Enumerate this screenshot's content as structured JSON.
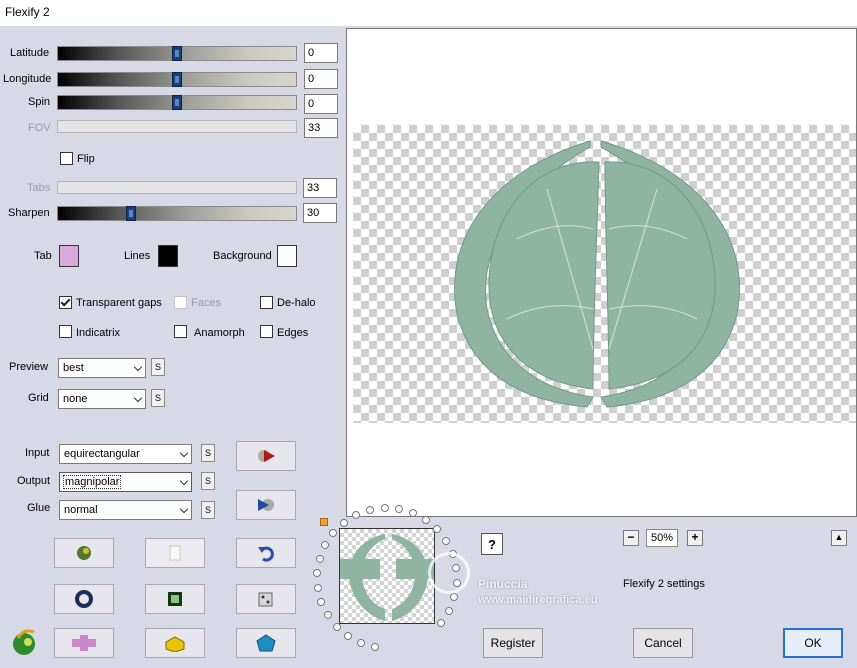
{
  "window": {
    "title": "Flexify 2"
  },
  "sliders": [
    {
      "label": "Latitude",
      "value": "0",
      "enabled": true,
      "level": 0.5
    },
    {
      "label": "Longitude",
      "value": "0",
      "enabled": true,
      "level": 0.5
    },
    {
      "label": "Spin",
      "value": "0",
      "enabled": true,
      "level": 0.5
    },
    {
      "label": "FOV",
      "value": "33",
      "enabled": false
    },
    {
      "label": "Tabs",
      "value": "33",
      "enabled": false
    },
    {
      "label": "Sharpen",
      "value": "30",
      "enabled": true,
      "level": 0.3
    }
  ],
  "flip": {
    "label": "Flip",
    "checked": false
  },
  "colors": {
    "tab": {
      "label": "Tab",
      "color": "#d9a8dc"
    },
    "lines": {
      "label": "Lines",
      "color": "#000000"
    },
    "background": {
      "label": "Background",
      "color": "#ffffff"
    }
  },
  "options": {
    "transparent_gaps": {
      "label": "Transparent gaps",
      "checked": true
    },
    "faces": {
      "label": "Faces",
      "checked": false,
      "enabled": false
    },
    "de_halo": {
      "label": "De-halo",
      "checked": false
    },
    "indicatrix": {
      "label": "Indicatrix",
      "checked": false
    },
    "anamorph": {
      "label": "Anamorph",
      "checked": false
    },
    "edges": {
      "label": "Edges",
      "checked": false
    }
  },
  "preview": {
    "label": "Preview",
    "value": "best"
  },
  "grid": {
    "label": "Grid",
    "value": "none"
  },
  "input": {
    "label": "Input",
    "value": "equirectangular"
  },
  "output": {
    "label": "Output",
    "value": "magnipolar"
  },
  "glue": {
    "label": "Glue",
    "value": "normal"
  },
  "s_button": "S",
  "zoom": {
    "value": "50%",
    "minus": "−",
    "plus": "+"
  },
  "help": "?",
  "settings_label": "Flexify 2 settings",
  "watermark": {
    "line1": "Pinuccia",
    "line2": "www.maidiregrafica.eu"
  },
  "buttons": {
    "register": "Register",
    "cancel": "Cancel",
    "ok": "OK"
  },
  "accent": "#2a6fd6",
  "sphere_color": "#8fb5a2"
}
